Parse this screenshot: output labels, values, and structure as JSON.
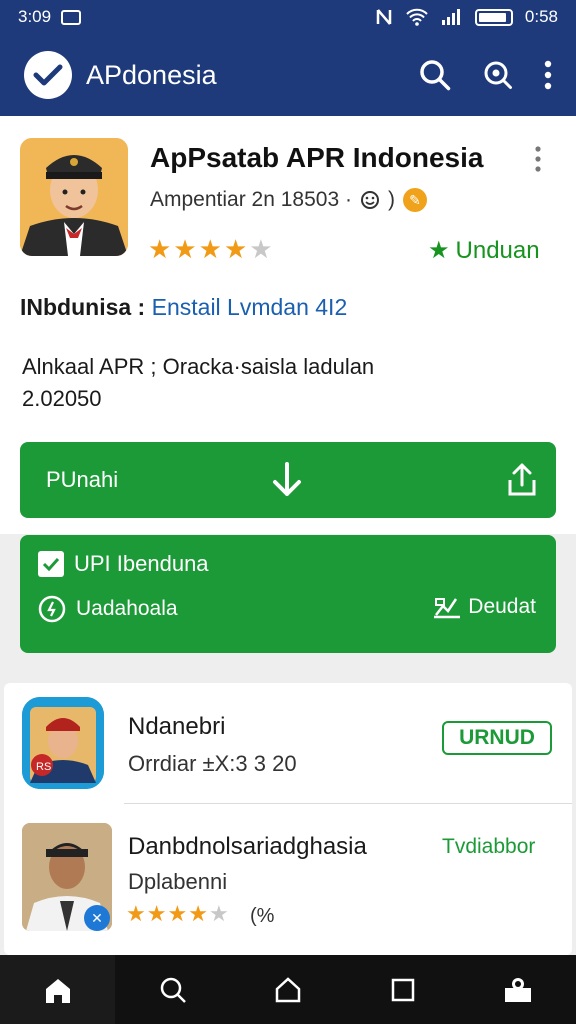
{
  "status_bar": {
    "time": "3:09",
    "battery": "0:58"
  },
  "app_bar": {
    "title": "APdonesia"
  },
  "app": {
    "title": "ApPsatab APR Indonesia",
    "subtitle": "Ampentiar 2n 18503 ·",
    "subtitle_suffix": ")",
    "rating": 4,
    "max_rating": 5,
    "action_label": "Unduan"
  },
  "info": {
    "line1_label": "INbdunisa :",
    "line1_link": "Enstail Lvmdan",
    "line1_badge": "4I2",
    "line2": "Alnkaal APR ;  Oracka·saisla ladulan",
    "line3": "2.02050"
  },
  "main_button": {
    "label": "PUnahi"
  },
  "panel": {
    "row1": "UPI Ibenduna",
    "row2": "Uadahoala",
    "right": "Deudat"
  },
  "list": [
    {
      "title": "Ndanebri",
      "subtitle": "Orrdiar ±X:3 3 20",
      "action": "URNUD",
      "icon_text": "RS"
    },
    {
      "title": "Danbdnolsariadghasia",
      "subtitle": "Dplabenni",
      "rating": 4,
      "extra": "(%",
      "action": "Tvdiabbor"
    }
  ],
  "colors": {
    "primary": "#1f3a7a",
    "green": "#1c9a38",
    "star": "#f19a16"
  }
}
